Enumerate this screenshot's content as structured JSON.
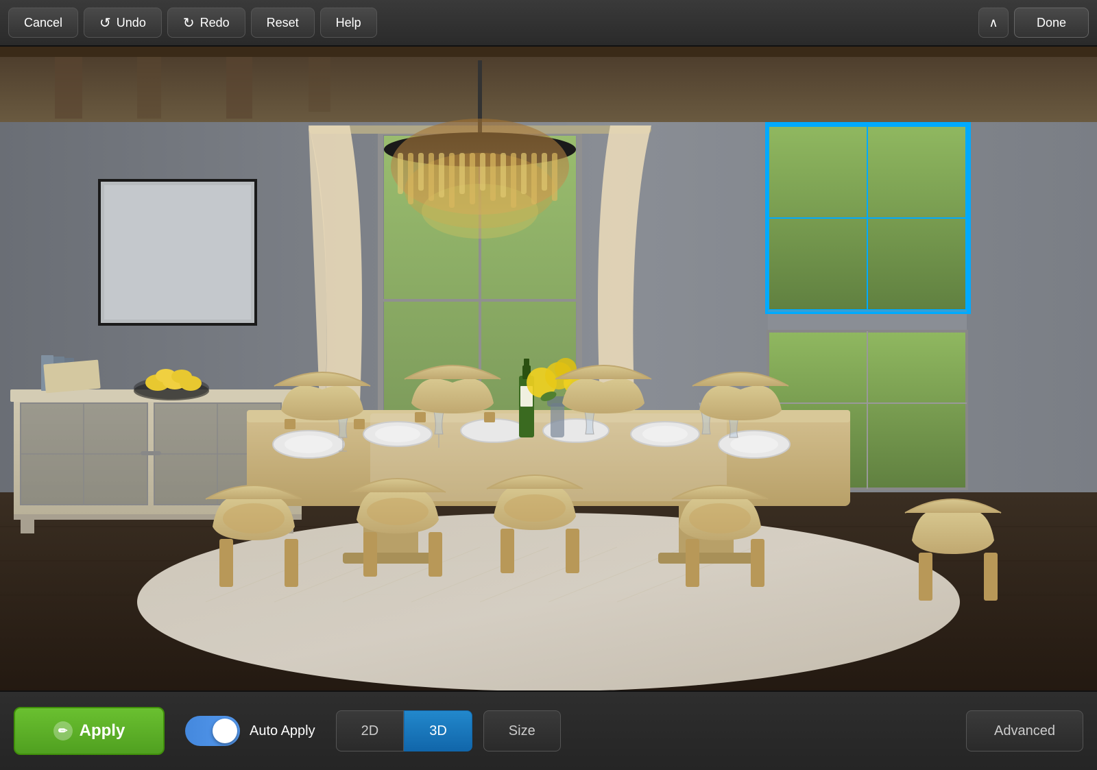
{
  "toolbar": {
    "cancel_label": "Cancel",
    "undo_label": "Undo",
    "redo_label": "Redo",
    "reset_label": "Reset",
    "help_label": "Help",
    "done_label": "Done"
  },
  "bottom_toolbar": {
    "apply_label": "Apply",
    "auto_apply_label": "Auto Apply",
    "view_2d_label": "2D",
    "view_3d_label": "3D",
    "size_label": "Size",
    "advanced_label": "Advanced",
    "toggle_state": "on",
    "active_view": "3D"
  },
  "scene": {
    "selection_visible": true
  }
}
